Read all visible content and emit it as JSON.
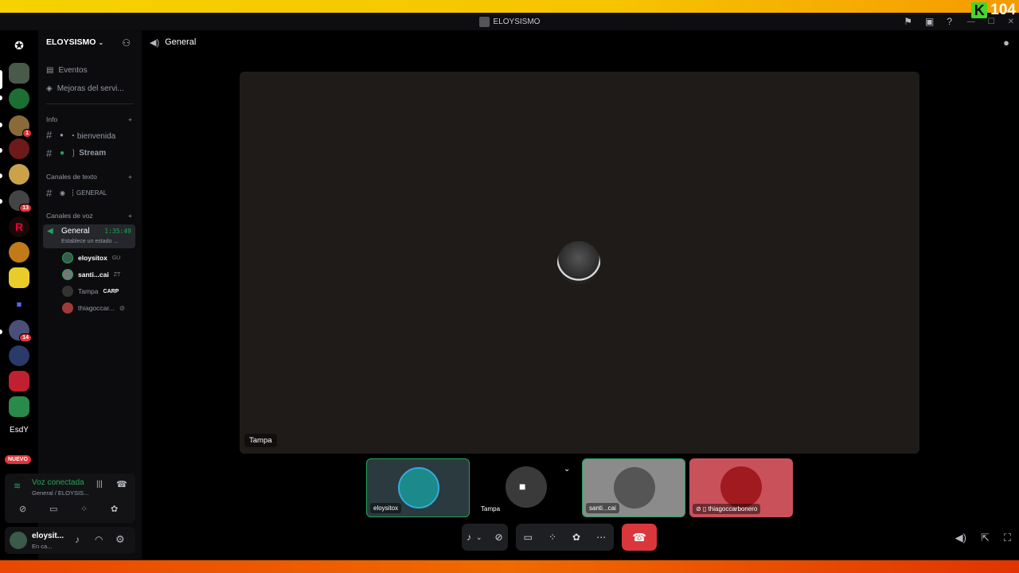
{
  "window_title": "ELOYSISMO",
  "kbadge": {
    "letter": "K",
    "count": "104"
  },
  "server": {
    "name": "ELOYSISMO"
  },
  "top_items": [
    {
      "label": "Eventos"
    },
    {
      "label": "Mejoras del servi..."
    }
  ],
  "categories": {
    "info": "Info",
    "text": "Canales de texto",
    "voice": "Canales de voz"
  },
  "channels": {
    "bienvenida": "・bienvenida",
    "stream": "❳ Stream",
    "general_text": "┆ GENERAL"
  },
  "voice_channel": {
    "name": "General",
    "timer": "1:35:49",
    "status": "Establece un estado ..."
  },
  "voice_users": [
    {
      "name": "eloysitox",
      "tag": "GU"
    },
    {
      "name": "santi...cai",
      "tag": "ZT"
    },
    {
      "name": "Tampa",
      "tag": "CARP"
    },
    {
      "name": "thiagoccar..."
    }
  ],
  "guild_badges": {
    "g3": "1",
    "g6": "13",
    "g12": "14"
  },
  "guild_text": "EsdY",
  "nuevo": "NUEVO",
  "voice_panel": {
    "status": "Voz conectada",
    "location": "General / ELOYSIS..."
  },
  "user": {
    "name": "eloysit...",
    "status": "En ca..."
  },
  "main_header": "General",
  "stage": {
    "name": "Tampa"
  },
  "tiles": [
    {
      "name": "eloysitox",
      "bg": "#2b3a3e"
    },
    {
      "name": "Tampa",
      "bg": "#000000"
    },
    {
      "name": "santi...cai",
      "bg": "#8b8b8b"
    },
    {
      "name": "thiagoccarbonero",
      "bg": "#c9525a"
    }
  ],
  "colors": {
    "accent_green": "#23a55a",
    "hangup": "#da373c",
    "badge": "#e0343b"
  }
}
